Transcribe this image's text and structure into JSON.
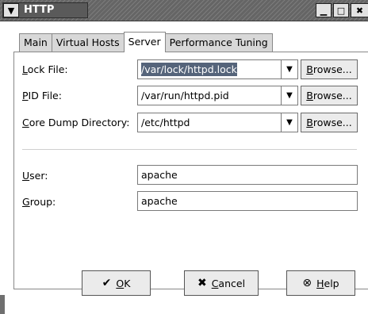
{
  "window": {
    "title": "HTTP",
    "menu_icon": "chevron-down-icon",
    "minimize_glyph": "▁",
    "maximize_glyph": "□",
    "close_glyph": "✖"
  },
  "tabs": [
    {
      "label": "Main",
      "active": false
    },
    {
      "label": "Virtual Hosts",
      "active": false
    },
    {
      "label": "Server",
      "active": true
    },
    {
      "label": "Performance Tuning",
      "active": false
    }
  ],
  "fields": {
    "lock_file": {
      "label_mnemonic": "L",
      "label_rest": "ock File:",
      "value": "/var/lock/httpd.lock"
    },
    "pid_file": {
      "label_mnemonic": "P",
      "label_rest": "ID File:",
      "value": "/var/run/httpd.pid"
    },
    "core_dump": {
      "label_mnemonic": "C",
      "label_rest": "ore Dump Directory:",
      "value": "/etc/httpd"
    },
    "user": {
      "label_mnemonic": "U",
      "label_rest": "ser:",
      "value": "apache"
    },
    "group": {
      "label_mnemonic": "G",
      "label_rest": "roup:",
      "value": "apache"
    }
  },
  "browse": {
    "mnemonic": "B",
    "rest": "rowse..."
  },
  "buttons": {
    "ok": {
      "mnemonic": "O",
      "rest": "K",
      "icon": "✔"
    },
    "cancel": {
      "mnemonic": "C",
      "rest": "ancel",
      "icon": "✖"
    },
    "help": {
      "mnemonic": "H",
      "rest": "elp",
      "icon": "⊗"
    }
  },
  "colors": {
    "selection": "#55647a",
    "titlebar": "#6f6f6f"
  }
}
